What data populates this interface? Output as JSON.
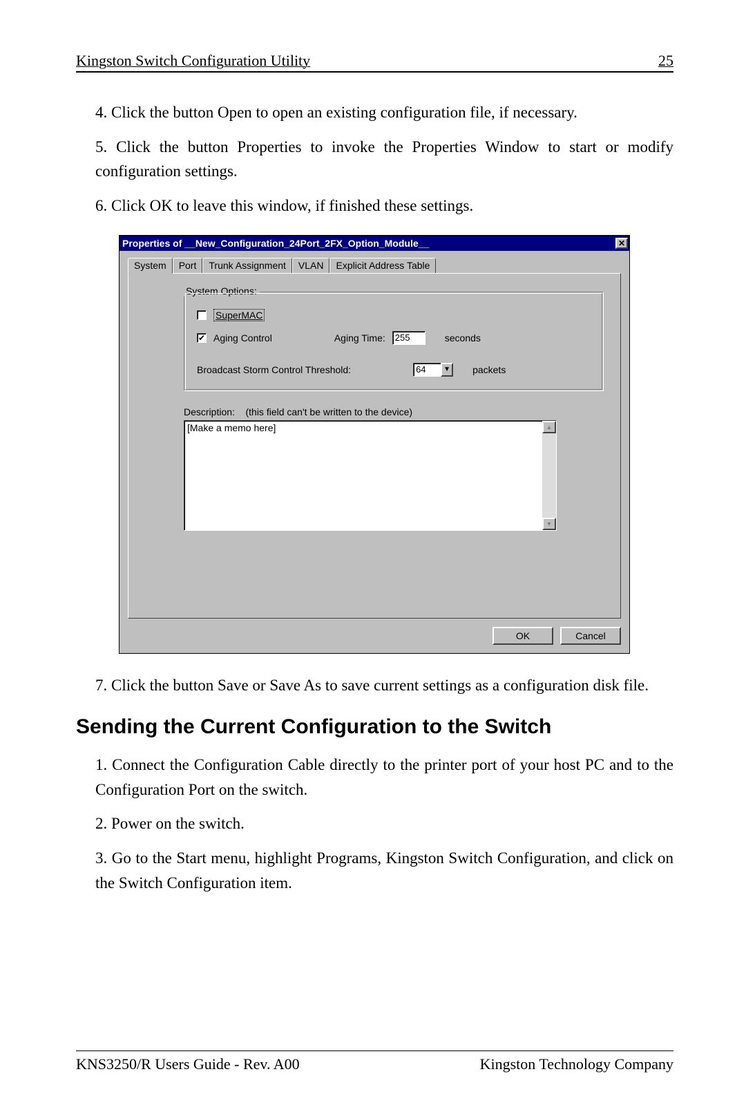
{
  "header": {
    "title": "Kingston Switch Configuration Utility",
    "page_number": "25"
  },
  "steps_upper": [
    "4. Click the button Open to open an existing configuration file, if necessary.",
    "5. Click the button Properties to invoke the Properties Window to start or modify configuration settings.",
    "6. Click OK to leave this window, if finished these settings."
  ],
  "dialog": {
    "title": "Properties of __New_Configuration_24Port_2FX_Option_Module__",
    "tabs": [
      "System",
      "Port",
      "Trunk Assignment",
      "VLAN",
      "Explicit Address Table"
    ],
    "active_tab_index": 0,
    "group_legend": "System Options:",
    "supermac": {
      "label": "SuperMAC",
      "checked": false
    },
    "aging": {
      "label": "Aging Control",
      "checked": true,
      "time_label": "Aging Time:",
      "time_value": "255",
      "unit": "seconds"
    },
    "bcast": {
      "label": "Broadcast Storm Control Threshold:",
      "value": "64",
      "unit": "packets"
    },
    "description": {
      "label": "Description:",
      "hint": "(this field can't be written to the device)",
      "value": "[Make a memo here]"
    },
    "buttons": {
      "ok": "OK",
      "cancel": "Cancel"
    }
  },
  "steps_lower_first": "7. Click the button Save or Save As to save current settings as a configuration disk file.",
  "section_heading": "Sending the Current Configuration to the Switch",
  "steps_send": [
    "1. Connect the Configuration Cable directly to the printer port of your host PC and to the Configuration Port on the switch.",
    "2. Power on the switch.",
    "3. Go to the Start menu, highlight Programs, Kingston Switch Configuration, and click on the Switch Configuration item."
  ],
  "footer": {
    "left": "KNS3250/R Users Guide - Rev. A00",
    "right": "Kingston Technology Company"
  }
}
